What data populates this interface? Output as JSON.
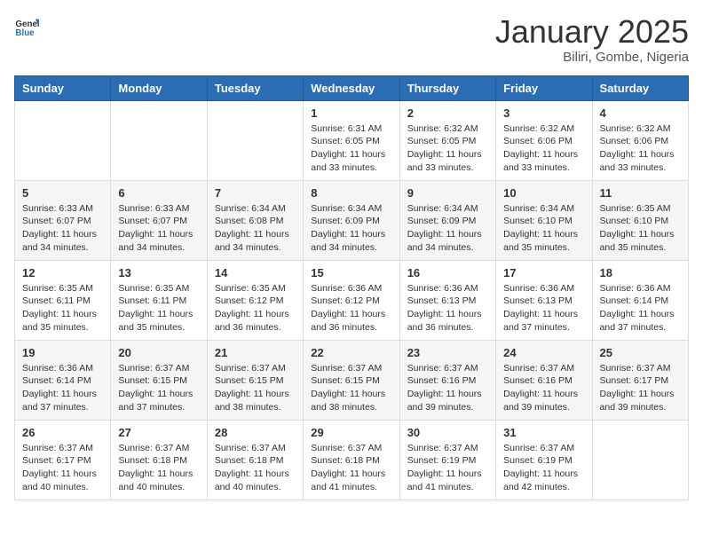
{
  "logo": {
    "general": "General",
    "blue": "Blue"
  },
  "title": {
    "month_year": "January 2025",
    "location": "Biliri, Gombe, Nigeria"
  },
  "weekdays": [
    "Sunday",
    "Monday",
    "Tuesday",
    "Wednesday",
    "Thursday",
    "Friday",
    "Saturday"
  ],
  "weeks": [
    [
      {
        "day": "",
        "info": ""
      },
      {
        "day": "",
        "info": ""
      },
      {
        "day": "",
        "info": ""
      },
      {
        "day": "1",
        "info": "Sunrise: 6:31 AM\nSunset: 6:05 PM\nDaylight: 11 hours and 33 minutes."
      },
      {
        "day": "2",
        "info": "Sunrise: 6:32 AM\nSunset: 6:05 PM\nDaylight: 11 hours and 33 minutes."
      },
      {
        "day": "3",
        "info": "Sunrise: 6:32 AM\nSunset: 6:06 PM\nDaylight: 11 hours and 33 minutes."
      },
      {
        "day": "4",
        "info": "Sunrise: 6:32 AM\nSunset: 6:06 PM\nDaylight: 11 hours and 33 minutes."
      }
    ],
    [
      {
        "day": "5",
        "info": "Sunrise: 6:33 AM\nSunset: 6:07 PM\nDaylight: 11 hours and 34 minutes."
      },
      {
        "day": "6",
        "info": "Sunrise: 6:33 AM\nSunset: 6:07 PM\nDaylight: 11 hours and 34 minutes."
      },
      {
        "day": "7",
        "info": "Sunrise: 6:34 AM\nSunset: 6:08 PM\nDaylight: 11 hours and 34 minutes."
      },
      {
        "day": "8",
        "info": "Sunrise: 6:34 AM\nSunset: 6:09 PM\nDaylight: 11 hours and 34 minutes."
      },
      {
        "day": "9",
        "info": "Sunrise: 6:34 AM\nSunset: 6:09 PM\nDaylight: 11 hours and 34 minutes."
      },
      {
        "day": "10",
        "info": "Sunrise: 6:34 AM\nSunset: 6:10 PM\nDaylight: 11 hours and 35 minutes."
      },
      {
        "day": "11",
        "info": "Sunrise: 6:35 AM\nSunset: 6:10 PM\nDaylight: 11 hours and 35 minutes."
      }
    ],
    [
      {
        "day": "12",
        "info": "Sunrise: 6:35 AM\nSunset: 6:11 PM\nDaylight: 11 hours and 35 minutes."
      },
      {
        "day": "13",
        "info": "Sunrise: 6:35 AM\nSunset: 6:11 PM\nDaylight: 11 hours and 35 minutes."
      },
      {
        "day": "14",
        "info": "Sunrise: 6:35 AM\nSunset: 6:12 PM\nDaylight: 11 hours and 36 minutes."
      },
      {
        "day": "15",
        "info": "Sunrise: 6:36 AM\nSunset: 6:12 PM\nDaylight: 11 hours and 36 minutes."
      },
      {
        "day": "16",
        "info": "Sunrise: 6:36 AM\nSunset: 6:13 PM\nDaylight: 11 hours and 36 minutes."
      },
      {
        "day": "17",
        "info": "Sunrise: 6:36 AM\nSunset: 6:13 PM\nDaylight: 11 hours and 37 minutes."
      },
      {
        "day": "18",
        "info": "Sunrise: 6:36 AM\nSunset: 6:14 PM\nDaylight: 11 hours and 37 minutes."
      }
    ],
    [
      {
        "day": "19",
        "info": "Sunrise: 6:36 AM\nSunset: 6:14 PM\nDaylight: 11 hours and 37 minutes."
      },
      {
        "day": "20",
        "info": "Sunrise: 6:37 AM\nSunset: 6:15 PM\nDaylight: 11 hours and 37 minutes."
      },
      {
        "day": "21",
        "info": "Sunrise: 6:37 AM\nSunset: 6:15 PM\nDaylight: 11 hours and 38 minutes."
      },
      {
        "day": "22",
        "info": "Sunrise: 6:37 AM\nSunset: 6:15 PM\nDaylight: 11 hours and 38 minutes."
      },
      {
        "day": "23",
        "info": "Sunrise: 6:37 AM\nSunset: 6:16 PM\nDaylight: 11 hours and 39 minutes."
      },
      {
        "day": "24",
        "info": "Sunrise: 6:37 AM\nSunset: 6:16 PM\nDaylight: 11 hours and 39 minutes."
      },
      {
        "day": "25",
        "info": "Sunrise: 6:37 AM\nSunset: 6:17 PM\nDaylight: 11 hours and 39 minutes."
      }
    ],
    [
      {
        "day": "26",
        "info": "Sunrise: 6:37 AM\nSunset: 6:17 PM\nDaylight: 11 hours and 40 minutes."
      },
      {
        "day": "27",
        "info": "Sunrise: 6:37 AM\nSunset: 6:18 PM\nDaylight: 11 hours and 40 minutes."
      },
      {
        "day": "28",
        "info": "Sunrise: 6:37 AM\nSunset: 6:18 PM\nDaylight: 11 hours and 40 minutes."
      },
      {
        "day": "29",
        "info": "Sunrise: 6:37 AM\nSunset: 6:18 PM\nDaylight: 11 hours and 41 minutes."
      },
      {
        "day": "30",
        "info": "Sunrise: 6:37 AM\nSunset: 6:19 PM\nDaylight: 11 hours and 41 minutes."
      },
      {
        "day": "31",
        "info": "Sunrise: 6:37 AM\nSunset: 6:19 PM\nDaylight: 11 hours and 42 minutes."
      },
      {
        "day": "",
        "info": ""
      }
    ]
  ]
}
